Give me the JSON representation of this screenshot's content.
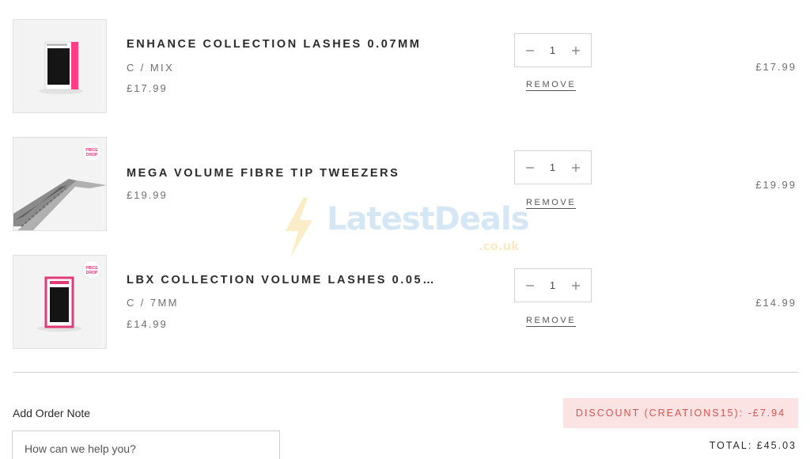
{
  "items": [
    {
      "title": "ENHANCE COLLECTION LASHES 0.07MM",
      "variant": "C / MIX",
      "price": "£17.99",
      "quantity": "1",
      "remove_label": "REMOVE",
      "line_total": "£17.99",
      "image_icon": "lash-tray-pink-icon"
    },
    {
      "title": "MEGA VOLUME FIBRE TIP TWEEZERS",
      "price": "£19.99",
      "quantity": "1",
      "remove_label": "REMOVE",
      "line_total": "£19.99",
      "badge_text": "PRICE DROP",
      "image_icon": "tweezers-icon"
    },
    {
      "title": "LBX COLLECTION VOLUME LASHES 0.05…",
      "variant": "C / 7MM",
      "price": "£14.99",
      "quantity": "1",
      "remove_label": "REMOVE",
      "line_total": "£14.99",
      "badge_text": "PRICE DROP",
      "image_icon": "lash-box-pink-icon"
    }
  ],
  "order_note": {
    "label": "Add Order Note",
    "placeholder": "How can we help you?"
  },
  "discount_label": "DISCOUNT (CREATIONS15): -£7.94",
  "total_label": "TOTAL: £45.03",
  "watermark": {
    "text": "LatestDeals",
    "sub": ".co.uk"
  },
  "colors": {
    "accent_pink": "#ff2d7a",
    "discount_bg": "#fbe3e3",
    "discount_text": "#d9534f"
  }
}
